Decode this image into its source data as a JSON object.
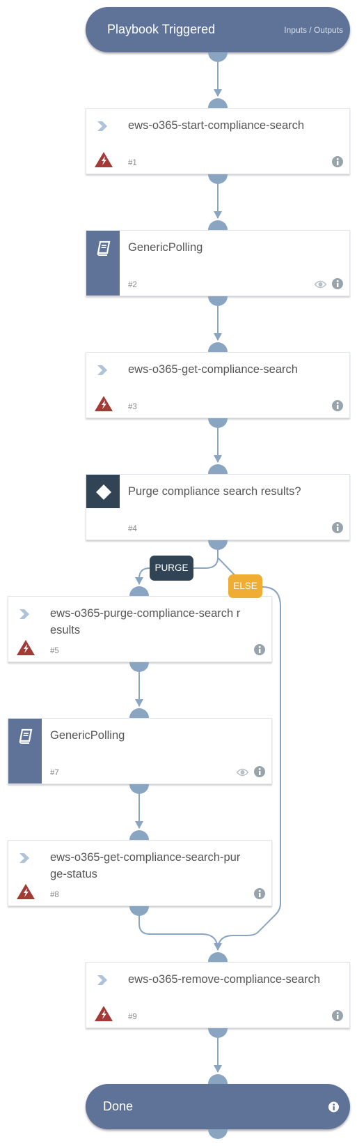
{
  "start": {
    "title": "Playbook Triggered",
    "link": "Inputs / Outputs"
  },
  "tasks": [
    {
      "id": "1",
      "number": "#1",
      "title": "ews-o365-start-compliance-search",
      "type": "integration",
      "icon": "chevron-right-icon",
      "warning": true,
      "has_eye": false
    },
    {
      "id": "2",
      "number": "#2",
      "title": "GenericPolling",
      "type": "playbook",
      "icon": "book-icon",
      "warning": false,
      "has_eye": true
    },
    {
      "id": "3",
      "number": "#3",
      "title": "ews-o365-get-compliance-search",
      "type": "integration",
      "icon": "chevron-right-icon",
      "warning": true,
      "has_eye": false
    },
    {
      "id": "4",
      "number": "#4",
      "title": "Purge compliance search results?",
      "type": "condition",
      "icon": "diamond-icon",
      "warning": false,
      "has_eye": false
    },
    {
      "id": "5",
      "number": "#5",
      "title": "ews-o365-purge-compliance-search results",
      "type": "integration",
      "icon": "chevron-right-icon",
      "warning": true,
      "has_eye": false
    },
    {
      "id": "7",
      "number": "#7",
      "title": "GenericPolling",
      "type": "playbook",
      "icon": "book-icon",
      "warning": false,
      "has_eye": true
    },
    {
      "id": "8",
      "number": "#8",
      "title": "ews-o365-get-compliance-search-purge-status",
      "type": "integration",
      "icon": "chevron-right-icon",
      "warning": true,
      "has_eye": false
    },
    {
      "id": "9",
      "number": "#9",
      "title": "ews-o365-remove-compliance-search",
      "type": "integration",
      "icon": "chevron-right-icon",
      "warning": true,
      "has_eye": false
    }
  ],
  "branches": {
    "purge": "PURGE",
    "else": "ELSE"
  },
  "end": {
    "title": "Done"
  },
  "colors": {
    "pill": "#5f7399",
    "edge": "#8aa5c2",
    "condition": "#304456",
    "else": "#f0ad33",
    "warning": "#a33a35",
    "info": "#98a4ac"
  }
}
